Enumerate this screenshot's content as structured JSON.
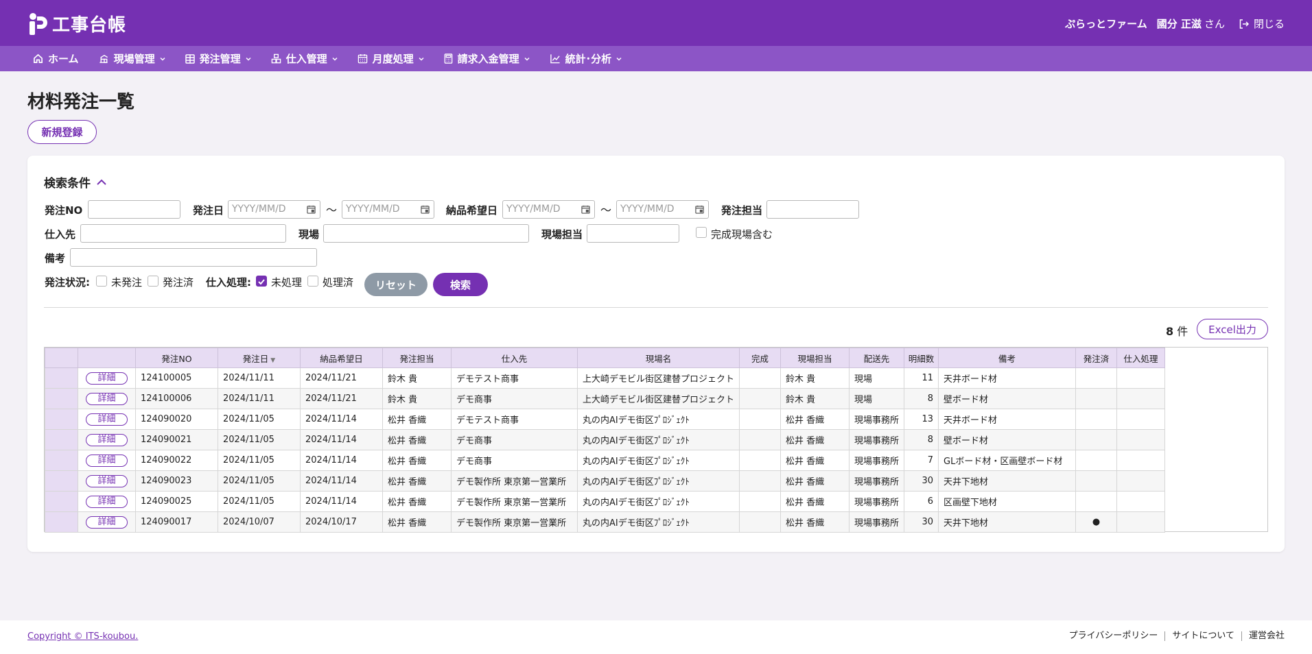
{
  "app": {
    "title": "工事台帳"
  },
  "header": {
    "company": "ぷらっとファーム",
    "user_name": "國分 正滋",
    "user_suffix": "さん",
    "logout_label": "閉じる"
  },
  "nav": [
    {
      "label": "ホーム",
      "icon": "home-icon"
    },
    {
      "label": "現場管理",
      "icon": "crane-icon"
    },
    {
      "label": "発注管理",
      "icon": "grid-icon"
    },
    {
      "label": "仕入管理",
      "icon": "boxes-icon"
    },
    {
      "label": "月度処理",
      "icon": "calendar-icon"
    },
    {
      "label": "請求入金管理",
      "icon": "calculator-icon"
    },
    {
      "label": "統計･分析",
      "icon": "chart-icon"
    }
  ],
  "page": {
    "title": "材料発注一覧",
    "new_button": "新規登録"
  },
  "search": {
    "header": "検索条件",
    "order_no_label": "発注NO",
    "order_date_label": "発注日",
    "delivery_label": "納品希望日",
    "date_placeholder": "YYYY/MM/D",
    "tilde": "〜",
    "staff_label": "発注担当",
    "supplier_label": "仕入先",
    "site_label": "現場",
    "site_staff_label": "現場担当",
    "include_completed": "完成現場含む",
    "remarks_label": "備考",
    "order_status_label": "発注状況:",
    "status_unordered": "未発注",
    "status_ordered": "発注済",
    "purchase_label": "仕入処理:",
    "purchase_pending": "未処理",
    "purchase_done": "処理済",
    "reset_button": "リセット",
    "search_button": "検索"
  },
  "results": {
    "count": "8",
    "count_unit": "件",
    "excel_button": "Excel出力"
  },
  "table": {
    "detail_label": "詳細",
    "sort_indicator": "▼",
    "headers": {
      "order_no": "発注NO",
      "order_date": "発注日",
      "delivery": "納品希望日",
      "staff": "発注担当",
      "supplier": "仕入先",
      "site": "現場名",
      "done": "完成",
      "site_staff": "現場担当",
      "dest": "配送先",
      "lines": "明細数",
      "remarks": "備考",
      "ordered": "発注済",
      "purchase": "仕入処理"
    },
    "rows": [
      {
        "order_no": "124100005",
        "order_date": "2024/11/11",
        "delivery": "2024/11/21",
        "staff": "鈴木 貴",
        "supplier": "デモテスト商事",
        "site": "上大崎デモビル街区建替プロジェクト",
        "done": "",
        "site_staff": "鈴木 貴",
        "dest": "現場",
        "lines": "11",
        "remarks": "天井ボード材",
        "ordered": "",
        "purchase": ""
      },
      {
        "order_no": "124100006",
        "order_date": "2024/11/11",
        "delivery": "2024/11/21",
        "staff": "鈴木 貴",
        "supplier": "デモ商事",
        "site": "上大崎デモビル街区建替プロジェクト",
        "done": "",
        "site_staff": "鈴木 貴",
        "dest": "現場",
        "lines": "8",
        "remarks": "壁ボード材",
        "ordered": "",
        "purchase": ""
      },
      {
        "order_no": "124090020",
        "order_date": "2024/11/05",
        "delivery": "2024/11/14",
        "staff": "松井 香織",
        "supplier": "デモテスト商事",
        "site": "丸の内AIデモ街区ﾌﾟﾛｼﾞｪｸﾄ",
        "done": "",
        "site_staff": "松井 香織",
        "dest": "現場事務所",
        "lines": "13",
        "remarks": "天井ボード材",
        "ordered": "",
        "purchase": ""
      },
      {
        "order_no": "124090021",
        "order_date": "2024/11/05",
        "delivery": "2024/11/14",
        "staff": "松井 香織",
        "supplier": "デモ商事",
        "site": "丸の内AIデモ街区ﾌﾟﾛｼﾞｪｸﾄ",
        "done": "",
        "site_staff": "松井 香織",
        "dest": "現場事務所",
        "lines": "8",
        "remarks": "壁ボード材",
        "ordered": "",
        "purchase": ""
      },
      {
        "order_no": "124090022",
        "order_date": "2024/11/05",
        "delivery": "2024/11/14",
        "staff": "松井 香織",
        "supplier": "デモ商事",
        "site": "丸の内AIデモ街区ﾌﾟﾛｼﾞｪｸﾄ",
        "done": "",
        "site_staff": "松井 香織",
        "dest": "現場事務所",
        "lines": "7",
        "remarks": "GLボード材・区画壁ボード材",
        "ordered": "",
        "purchase": ""
      },
      {
        "order_no": "124090023",
        "order_date": "2024/11/05",
        "delivery": "2024/11/14",
        "staff": "松井 香織",
        "supplier": "デモ製作所 東京第一営業所",
        "site": "丸の内AIデモ街区ﾌﾟﾛｼﾞｪｸﾄ",
        "done": "",
        "site_staff": "松井 香織",
        "dest": "現場事務所",
        "lines": "30",
        "remarks": "天井下地材",
        "ordered": "",
        "purchase": ""
      },
      {
        "order_no": "124090025",
        "order_date": "2024/11/05",
        "delivery": "2024/11/14",
        "staff": "松井 香織",
        "supplier": "デモ製作所 東京第一営業所",
        "site": "丸の内AIデモ街区ﾌﾟﾛｼﾞｪｸﾄ",
        "done": "",
        "site_staff": "松井 香織",
        "dest": "現場事務所",
        "lines": "6",
        "remarks": "区画壁下地材",
        "ordered": "",
        "purchase": ""
      },
      {
        "order_no": "124090017",
        "order_date": "2024/10/07",
        "delivery": "2024/10/17",
        "staff": "松井 香織",
        "supplier": "デモ製作所 東京第一営業所",
        "site": "丸の内AIデモ街区ﾌﾟﾛｼﾞｪｸﾄ",
        "done": "",
        "site_staff": "松井 香織",
        "dest": "現場事務所",
        "lines": "30",
        "remarks": "天井下地材",
        "ordered": "●",
        "purchase": ""
      }
    ]
  },
  "footer": {
    "copyright": "Copyright © ITS-koubou.",
    "links": [
      "プライバシーポリシー",
      "サイトについて",
      "運営会社"
    ]
  },
  "colors": {
    "primary": "#7530b2",
    "nav": "#8c55c6",
    "table_header": "#e7dcf3"
  }
}
